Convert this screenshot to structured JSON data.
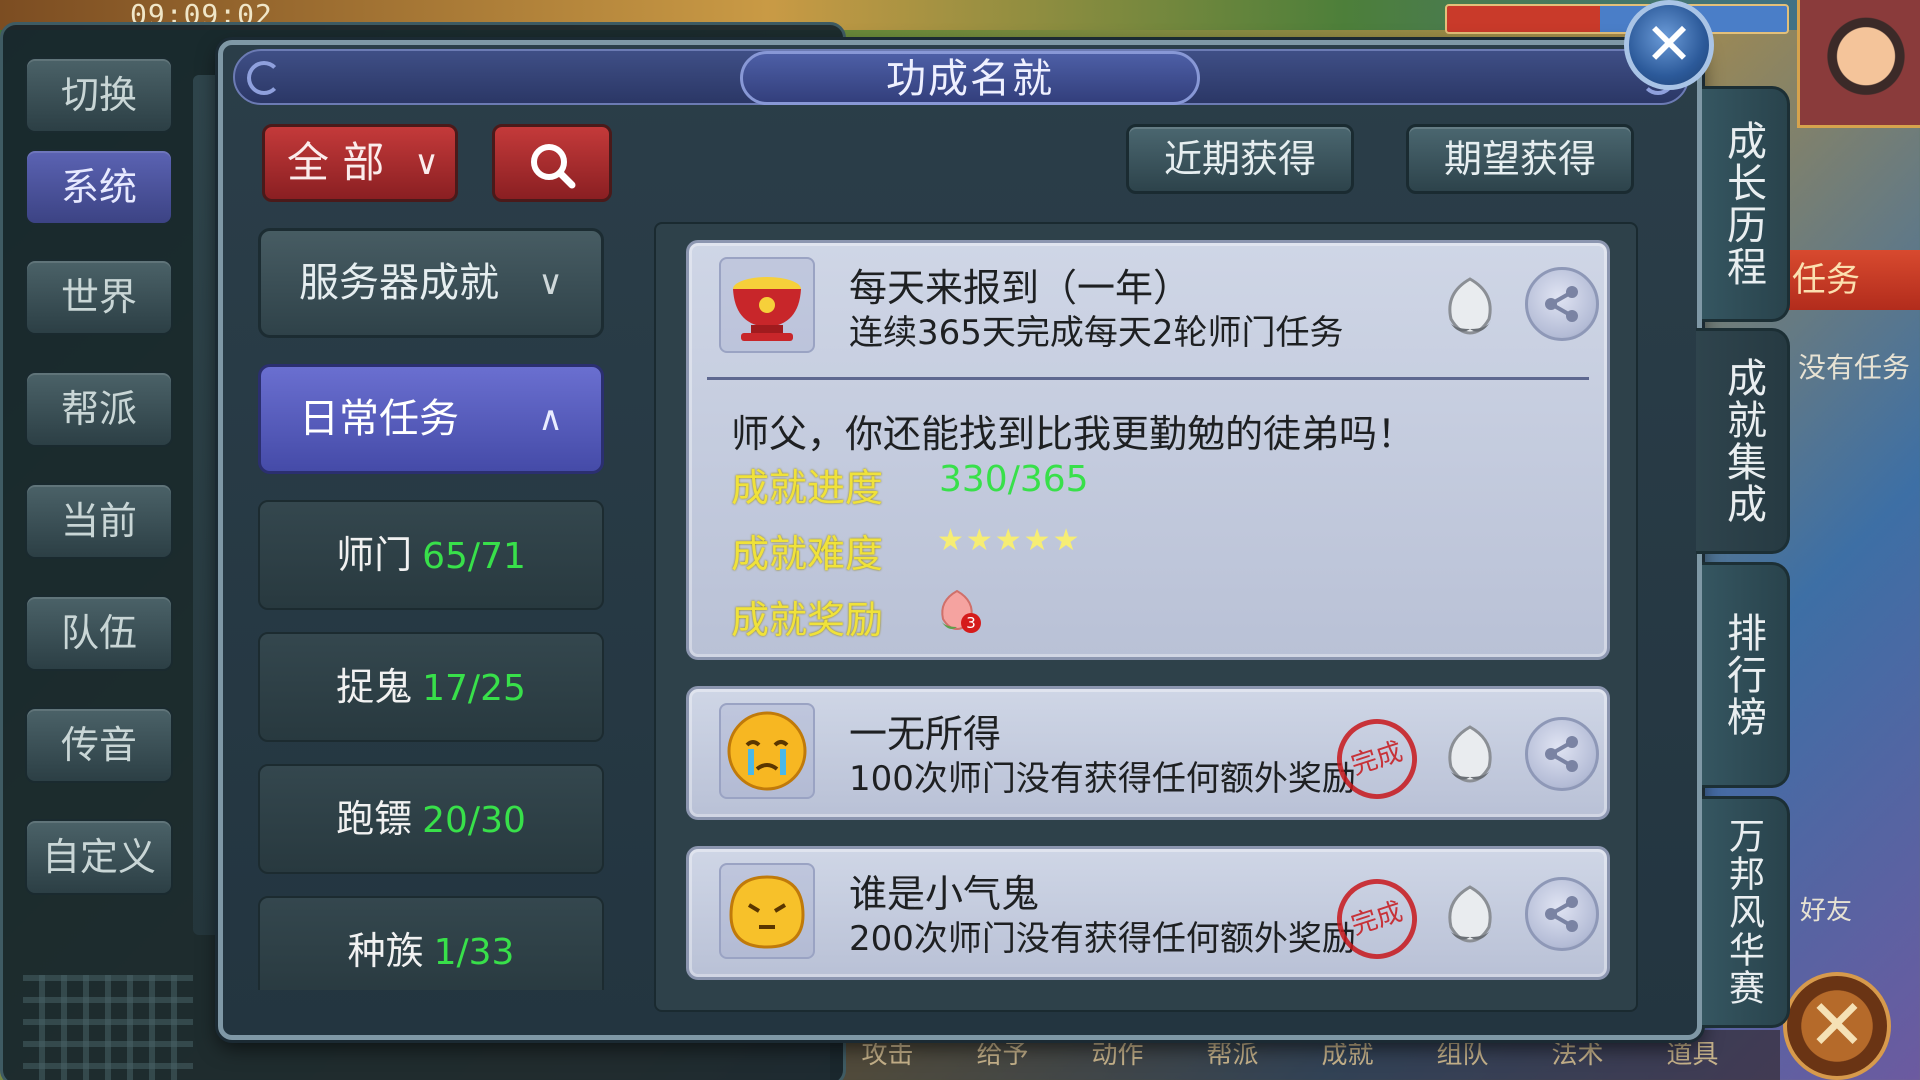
{
  "status_bar": {
    "time": "09:09:02"
  },
  "chat_tabs": [
    {
      "label": "切换"
    },
    {
      "label": "系统"
    },
    {
      "label": "世界"
    },
    {
      "label": "帮派"
    },
    {
      "label": "当前"
    },
    {
      "label": "队伍"
    },
    {
      "label": "传音"
    },
    {
      "label": "自定义"
    }
  ],
  "dialog": {
    "title": "功成名就",
    "close_icon": "close-icon",
    "filter": {
      "label": "全 部",
      "chevron": "⌄"
    },
    "search_icon": "search-icon",
    "recent_label": "近期获得",
    "expected_label": "期望获得",
    "category": {
      "label": "服务器成就"
    },
    "active_category": {
      "label": "日常任务"
    },
    "sub_items": [
      {
        "name": "师门",
        "count": "65/71"
      },
      {
        "name": "捉鬼",
        "count": "17/25"
      },
      {
        "name": "跑镖",
        "count": "20/30"
      },
      {
        "name": "种族",
        "count": "1/33"
      }
    ],
    "cards": [
      {
        "title": "每天来报到（一年）",
        "desc": "连续365天完成每天2轮师门任务",
        "quote": "师父，你还能找到比我更勤勉的徒弟吗！",
        "progress_label": "成就进度",
        "progress_value": "330/365",
        "difficulty_label": "成就难度",
        "difficulty_stars": "★★★★★",
        "reward_label": "成就奖励",
        "reward_count": "3"
      },
      {
        "title": "一无所得",
        "desc": "100次师门没有获得任何额外奖励",
        "stamp": "完成"
      },
      {
        "title": "谁是小气鬼",
        "desc": "200次师门没有获得任何额外奖励",
        "stamp": "完成"
      }
    ]
  },
  "side_tabs": [
    {
      "label": "成长历程"
    },
    {
      "label": "成就集成"
    },
    {
      "label": "排行榜"
    },
    {
      "label": "万邦风华赛"
    }
  ],
  "background": {
    "task_text": "任务",
    "no_task_text": "没有任务",
    "friend_text": "好友",
    "bottom_menu": [
      "攻击",
      "给予",
      "动作",
      "帮派",
      "成就",
      "组队",
      "法术",
      "道具"
    ]
  },
  "colors": {
    "count_green": "#38e04a",
    "label_yellow": "#f0e23a",
    "filter_red": "#c43a3a",
    "active_purple": "#6a6fd0"
  }
}
